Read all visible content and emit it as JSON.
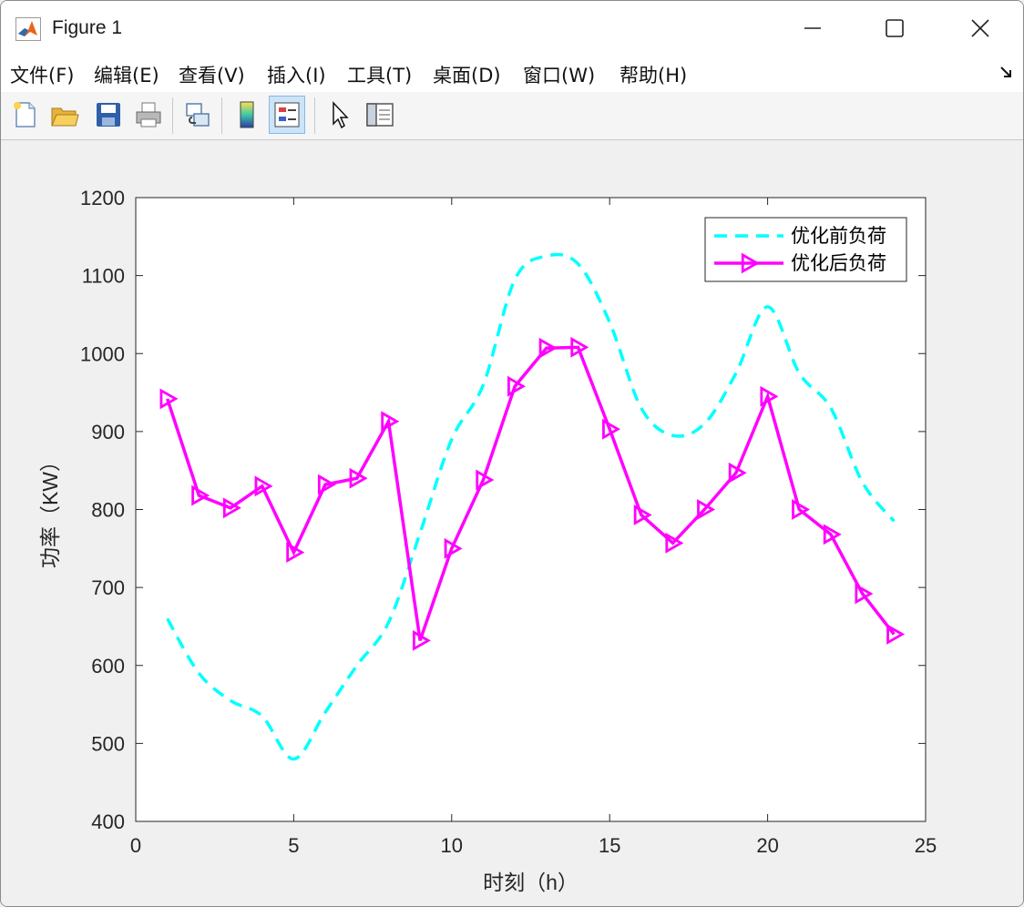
{
  "window": {
    "title": "Figure 1"
  },
  "menu": [
    "文件(F)",
    "编辑(E)",
    "查看(V)",
    "插入(I)",
    "工具(T)",
    "桌面(D)",
    "窗口(W)",
    "帮助(H)"
  ],
  "toolbar": {
    "icons": [
      "new-figure-icon",
      "open-file-icon",
      "save-icon",
      "print-icon",
      "link-plot-icon",
      "insert-colorbar-icon",
      "insert-legend-icon",
      "edit-plot-icon",
      "property-inspector-icon"
    ],
    "active": "insert-legend-icon"
  },
  "chart_data": {
    "type": "line",
    "title": "",
    "xlabel": "时刻（h）",
    "ylabel": "功率（KW）",
    "xlim": [
      0,
      25
    ],
    "ylim": [
      400,
      1200
    ],
    "xticks": [
      0,
      5,
      10,
      15,
      20,
      25
    ],
    "yticks": [
      400,
      500,
      600,
      700,
      800,
      900,
      1000,
      1100,
      1200
    ],
    "grid": false,
    "legend_position": "top-right",
    "x": [
      1,
      2,
      3,
      4,
      5,
      6,
      7,
      8,
      9,
      10,
      11,
      12,
      13,
      14,
      15,
      16,
      17,
      18,
      19,
      20,
      21,
      22,
      23,
      24
    ],
    "series": [
      {
        "name": "优化前负荷",
        "color": "#00ffff",
        "style": "dashed",
        "marker": "none",
        "values": [
          660,
          590,
          555,
          535,
          480,
          540,
          600,
          655,
          770,
          890,
          960,
          1095,
          1125,
          1115,
          1040,
          930,
          895,
          910,
          975,
          1060,
          975,
          930,
          835,
          785
        ]
      },
      {
        "name": "优化后负荷",
        "color": "#ff00ff",
        "style": "solid",
        "marker": "triangle-right",
        "values": [
          942,
          818,
          802,
          830,
          745,
          832,
          840,
          913,
          632,
          750,
          838,
          958,
          1007,
          1008,
          903,
          793,
          757,
          800,
          847,
          945,
          800,
          768,
          692,
          640
        ]
      }
    ]
  }
}
